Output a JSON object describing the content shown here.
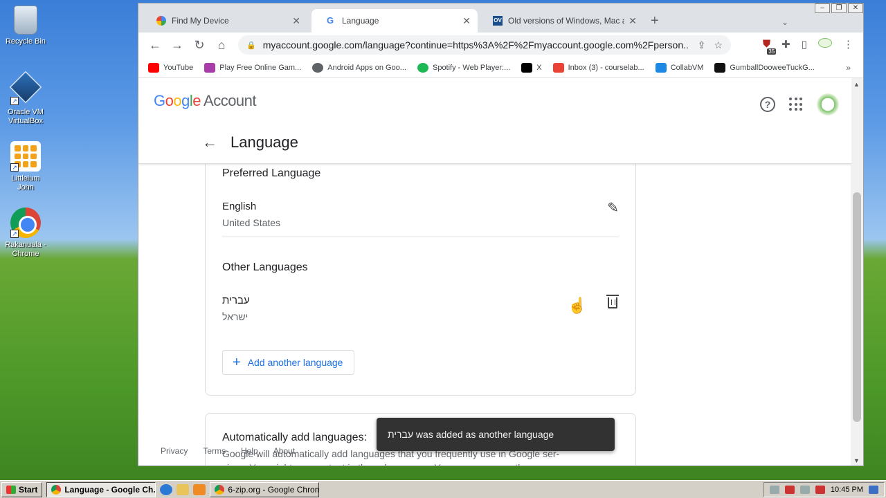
{
  "desktop": {
    "icons": [
      {
        "label": "Recycle Bin"
      },
      {
        "label": "Oracle VM VirtualBox"
      },
      {
        "label": "Littleium John"
      },
      {
        "label": "Rakanuala - Chrome"
      }
    ]
  },
  "browser": {
    "tabs": [
      {
        "label": "Find My Device"
      },
      {
        "label": "Language"
      },
      {
        "label": "Old versions of Windows, Mac and Linux"
      }
    ],
    "address": "myaccount.google.com/language?continue=https%3A%2F%2Fmyaccount.google.com%2Fperson...",
    "extension_badge": "35",
    "bookmarks": [
      {
        "label": "YouTube",
        "color": "#ff0000"
      },
      {
        "label": "Play Free Online Gam...",
        "color": "#a83ca8"
      },
      {
        "label": "Android Apps on Goo...",
        "color": "#5f6368"
      },
      {
        "label": "Spotify - Web Player:...",
        "color": "#1db954"
      },
      {
        "label": "X",
        "color": "#000000"
      },
      {
        "label": "Inbox (3) - courselab...",
        "color": "#ea4335"
      },
      {
        "label": "CollabVM",
        "color": "#1e88e5"
      },
      {
        "label": "GumballDooweeTuckG...",
        "color": "#111111"
      }
    ]
  },
  "page": {
    "brand": {
      "g": "G",
      "o1": "o",
      "o2": "o",
      "g2": "g",
      "l": "l",
      "e": "e",
      "account": "Account"
    },
    "title": "Language",
    "preferred": {
      "heading": "Preferred Language",
      "name": "English",
      "region": "United States"
    },
    "other": {
      "heading": "Other Languages",
      "name": "עברית",
      "region": "ישראל"
    },
    "add_button": "Add another language",
    "auto": {
      "title": "Automatically add languages:",
      "description": "Google will automatically add languages that you frequently use in Google ser-vices. You might see content in these languages. You can permanently save or"
    },
    "footer": [
      "Privacy",
      "Terms",
      "Help",
      "About"
    ],
    "snackbar": "עברית was added as another language"
  },
  "taskbar": {
    "start": "Start",
    "items": [
      {
        "label": "Language - Google Ch..."
      },
      {
        "label": "6-zip.org - Google Chrome"
      }
    ],
    "clock": "10:45 PM"
  },
  "colors": {
    "accent": "#1a73e8",
    "snackbar": "#323232"
  }
}
